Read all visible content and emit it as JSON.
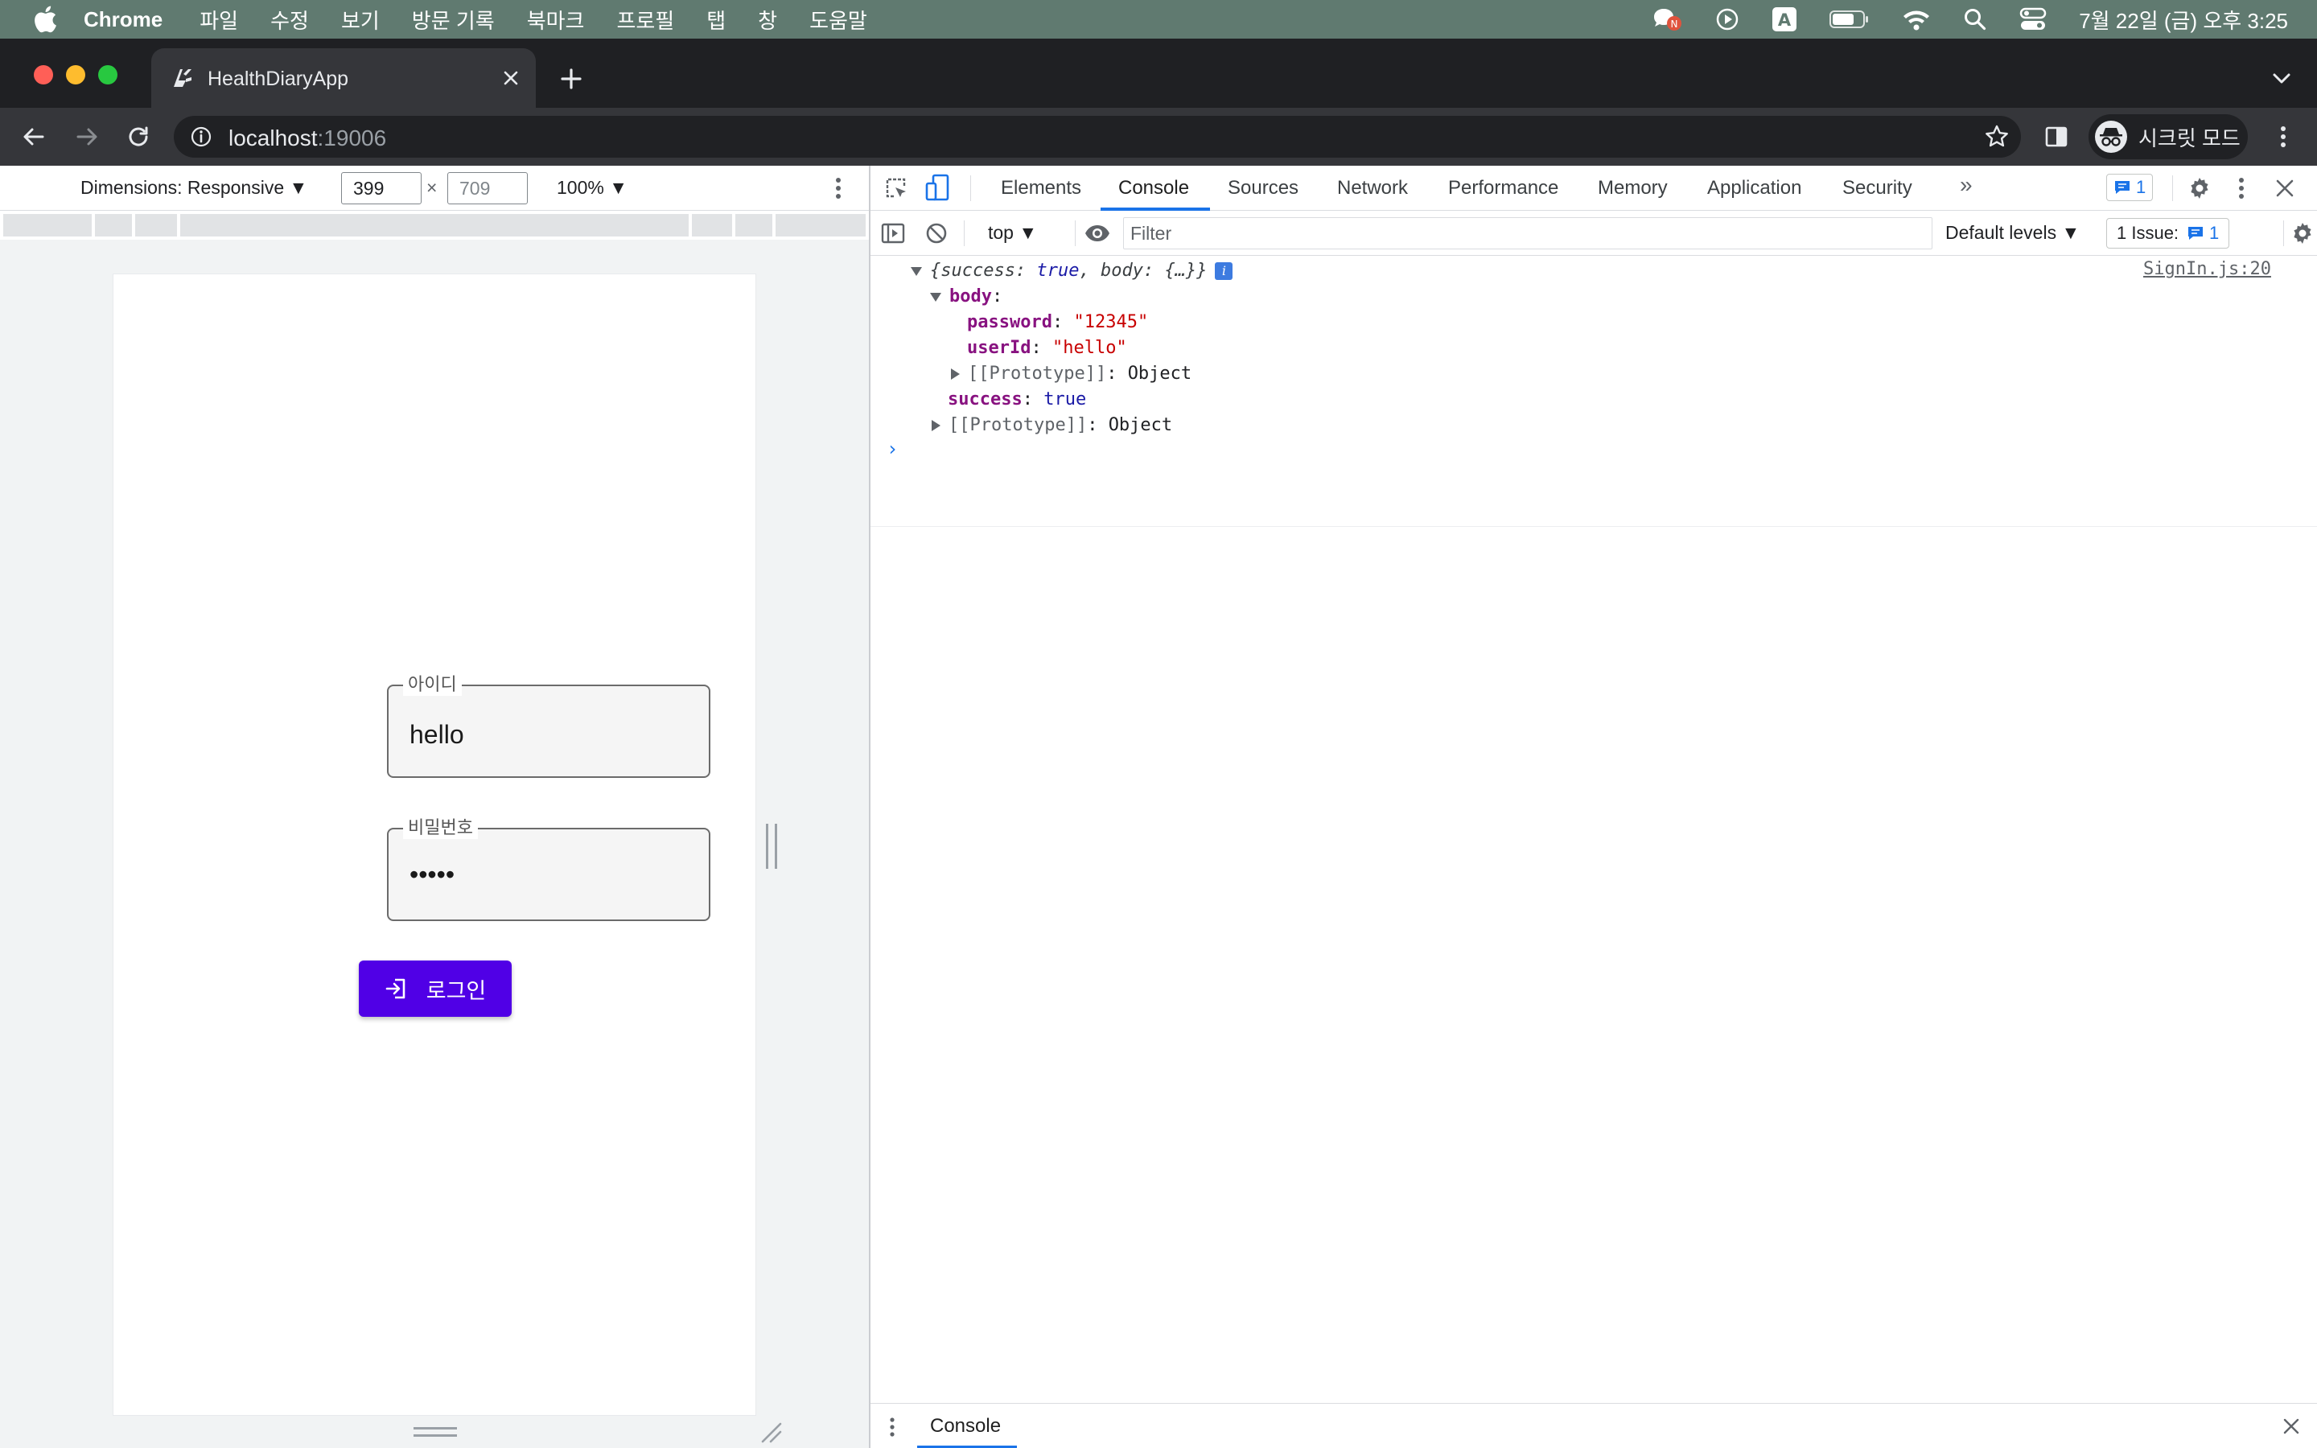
{
  "menubar": {
    "app_name": "Chrome",
    "items": [
      "파일",
      "수정",
      "보기",
      "방문 기록",
      "북마크",
      "프로필",
      "탭",
      "창",
      "도움말"
    ],
    "clock": "7월 22일 (금) 오후 3:25",
    "input_indicator": "A"
  },
  "browser": {
    "tab_title": "HealthDiaryApp",
    "url_host": "localhost",
    "url_port": ":19006",
    "incognito_label": "시크릿 모드"
  },
  "device_toolbar": {
    "dimensions_label": "Dimensions: Responsive ▼",
    "width": "399",
    "times": "×",
    "height": "709",
    "zoom": "100% ▼"
  },
  "app": {
    "id_label": "아이디",
    "id_value": "hello",
    "password_label": "비밀번호",
    "password_value": "•••••",
    "login_button": "로그인",
    "accent_color": "#5000e6"
  },
  "devtools": {
    "tabs": [
      "Elements",
      "Console",
      "Sources",
      "Network",
      "Performance",
      "Memory",
      "Application",
      "Security"
    ],
    "active_tab": "Console",
    "overflow": "»",
    "message_count": "1",
    "context": "top ▼",
    "filter_placeholder": "Filter",
    "levels": "Default levels ▼",
    "issue_label": "1 Issue:",
    "issue_count": "1",
    "drawer_tab": "Console"
  },
  "console": {
    "summary": "{success: true, body: {…}}",
    "summary_parts": {
      "open": "{",
      "k1": "success",
      "colon": ": ",
      "v1": "true",
      "comma": ", ",
      "k2": "body",
      "v2": "{…}",
      "close": "}"
    },
    "source": "SignIn.js:20",
    "body_key": "body",
    "password_key": "password",
    "password_val": "\"12345\"",
    "userid_key": "userId",
    "userid_val": "\"hello\"",
    "proto_key": "[[Prototype]]",
    "proto_val": "Object",
    "success_key": "success",
    "success_val": "true",
    "colon": ": ",
    "prompt": "›"
  }
}
